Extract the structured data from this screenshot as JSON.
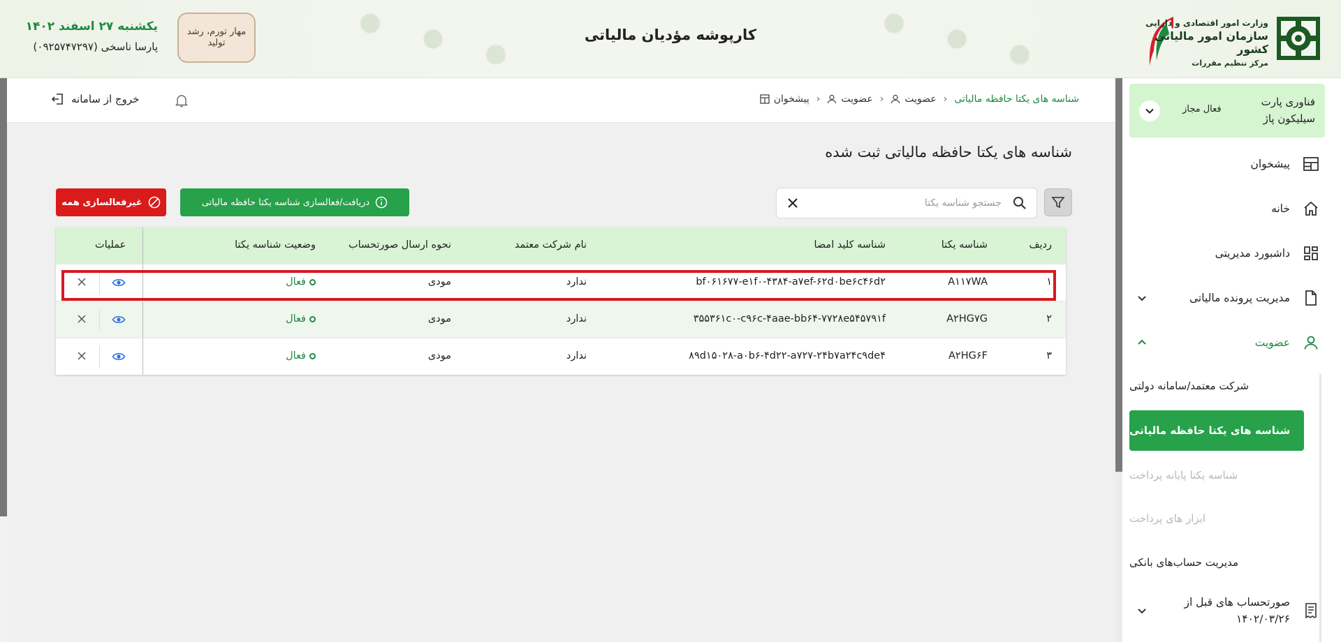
{
  "header": {
    "title": "کارپوشه مؤدیان مالیاتی",
    "date": "یکشنبه ۲۷ اسفند ۱۴۰۲",
    "user": "پارسا ناسخی (۰۹۲۵۷۴۷۲۹۷)",
    "stamp_text": "مهار تورم، رشد تولید",
    "org_line1": "وزارت امور اقتصادی و دارایی",
    "org_line2": "سازمان امور مالیاتی کشور",
    "org_line3": "مرکز تنظیم مقررات"
  },
  "topbar": {
    "logout_label": "خروج از سامانه",
    "breadcrumb": [
      {
        "label": "پیشخوان"
      },
      {
        "label": "عضویت"
      },
      {
        "label": "عضویت"
      },
      {
        "label": "شناسه های یکتا حافظه مالیاتی"
      }
    ]
  },
  "page": {
    "title": "شناسه های یکتا حافظه مالیاتی ثبت شده",
    "search_placeholder": "جستجو شناسه یکتا",
    "green_button": "دریافت/فعالسازی شناسه یکتا حافظه مالیاتی",
    "red_button": "غیرفعالسازی همه"
  },
  "table": {
    "headers": {
      "row": "ردیف",
      "uid": "شناسه یکتا",
      "sign_key": "شناسه کلید امضا",
      "company": "نام شرکت معتمد",
      "send_method": "نحوه ارسال صورتحساب",
      "status": "وضعیت شناسه یکتا",
      "ops": "عملیات"
    },
    "rows": [
      {
        "row": "۱",
        "uid": "A۱۱۷WA",
        "sign_key": "bf۰۶۱۶۷۷-e۱f۰-۴۳۸۴-a۷ef-۶۲d۰be۶c۴۶d۲",
        "company": "ندارد",
        "send_method": "مودی",
        "status": "فعال"
      },
      {
        "row": "۲",
        "uid": "A۲HG۷G",
        "sign_key": "۳۵۵۳۶۱c۰-c۹۶c-۴aae-bb۶۴-۷۷۲۸e۵۴۵۷۹۱f",
        "company": "ندارد",
        "send_method": "مودی",
        "status": "فعال"
      },
      {
        "row": "۳",
        "uid": "A۲HG۶F",
        "sign_key": "۸۹d۱۵۰۲۸-a۰b۶-۴d۲۲-a۷۲۷-۲۴b۷a۲۴c۹de۴",
        "company": "ندارد",
        "send_method": "مودی",
        "status": "فعال"
      }
    ]
  },
  "sidebar": {
    "company": "فناوری پارت سیلیکون پاژ",
    "company_status": "فعال مجاز",
    "items": [
      {
        "label": "پیشخوان",
        "icon": "dashboard-icon"
      },
      {
        "label": "خانه",
        "icon": "home-icon"
      },
      {
        "label": "داشبورد مدیریتی",
        "icon": "grid-icon"
      },
      {
        "label": "مدیریت پرونده مالیاتی",
        "icon": "file-icon"
      },
      {
        "label": "عضویت",
        "icon": "user-icon"
      }
    ],
    "sub_items": [
      {
        "label": "شرکت معتمد/سامانه دولتی"
      },
      {
        "label": "شناسه های یکتا حافظه مالیاتی"
      },
      {
        "label": "شناسه یکتا پایانه پرداخت"
      },
      {
        "label": "ابزار های پرداخت"
      },
      {
        "label": "مدیریت حساب‌های بانکی"
      }
    ],
    "last_item_line1": "صورتحساب های قبل از",
    "last_item_line2": "۱۴۰۲/۰۳/۲۶"
  },
  "colors": {
    "accent": "#27a14a",
    "danger": "#d91b1b",
    "header_row": "#d9f3d5",
    "highlight": "#d71920"
  }
}
